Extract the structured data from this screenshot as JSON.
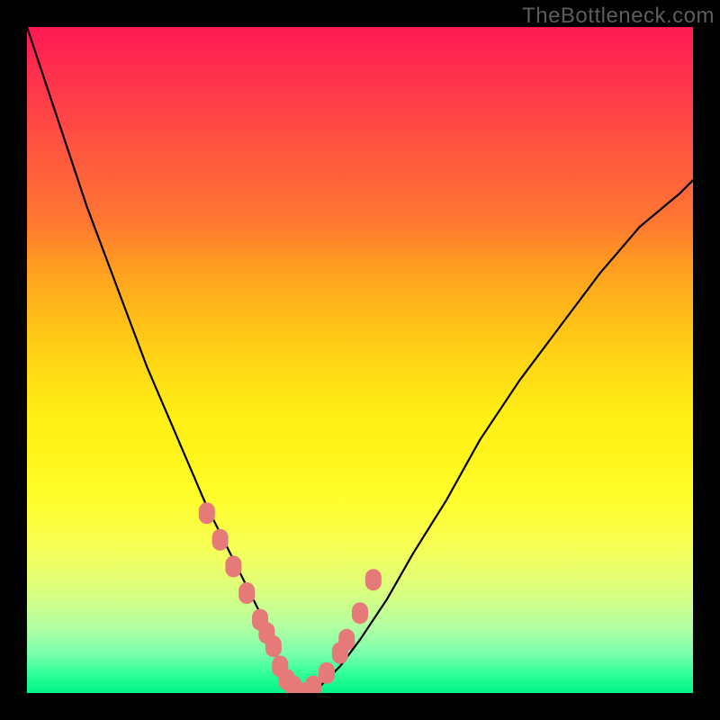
{
  "watermark": "TheBottleneck.com",
  "colors": {
    "curve_stroke": "#000000",
    "marker_fill": "#e57a78",
    "bg_frame": "#000000"
  },
  "chart_data": {
    "type": "line",
    "title": "",
    "xlabel": "",
    "ylabel": "",
    "xlim": [
      0,
      100
    ],
    "ylim": [
      0,
      100
    ],
    "curve": {
      "x": [
        0,
        3,
        6,
        9,
        12,
        15,
        18,
        21,
        24,
        27,
        30,
        32,
        34,
        36,
        37,
        38,
        40,
        42,
        44,
        47,
        50,
        54,
        58,
        63,
        68,
        74,
        80,
        86,
        92,
        98,
        100
      ],
      "y": [
        100,
        91,
        82,
        73,
        65,
        57,
        49,
        42,
        35,
        28,
        22,
        18,
        14,
        10,
        7,
        4,
        1,
        0,
        1,
        4,
        8,
        14,
        21,
        29,
        38,
        47,
        55,
        63,
        70,
        75,
        77
      ]
    },
    "markers": {
      "x": [
        27,
        29,
        31,
        33,
        35,
        36,
        37,
        38,
        39,
        40,
        41,
        42,
        43,
        45,
        47,
        48,
        50,
        52
      ],
      "y": [
        27,
        23,
        19,
        15,
        11,
        9,
        7,
        4,
        2,
        1,
        0,
        0,
        1,
        3,
        6,
        8,
        12,
        17
      ]
    }
  }
}
